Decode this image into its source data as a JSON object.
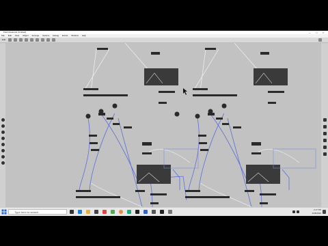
{
  "window": {
    "title": "Patch Example (Untitled)"
  },
  "menu": {
    "items": [
      "File",
      "Edit",
      "View",
      "Object",
      "Arrange",
      "Options",
      "Debug",
      "Extras",
      "Window",
      "Help"
    ]
  },
  "toolbar": {
    "mode_label": "Edit"
  },
  "taskbar": {
    "search_placeholder": "Type here to search",
    "time": "2:17 PM",
    "date": "4/28/2020"
  },
  "icons": {
    "start": "windows-logo-icon",
    "search": "search-icon",
    "apps": [
      "task-view-icon",
      "edge-icon",
      "file-explorer-icon",
      "store-icon",
      "mail-icon",
      "app-icon",
      "chrome-icon",
      "music-icon",
      "terminal-icon",
      "editor-icon",
      "app2-icon",
      "app3-icon",
      "app4-icon"
    ],
    "tray": [
      "network-icon",
      "volume-icon",
      "notification-icon"
    ]
  },
  "colors": {
    "canvas": "#c2c2c2",
    "patch_cord_blue": "#5a6fd8",
    "patch_cord_white": "#f4f4f4",
    "object_box": "#2a2a2a",
    "display_panel": "#3a3a3a"
  }
}
